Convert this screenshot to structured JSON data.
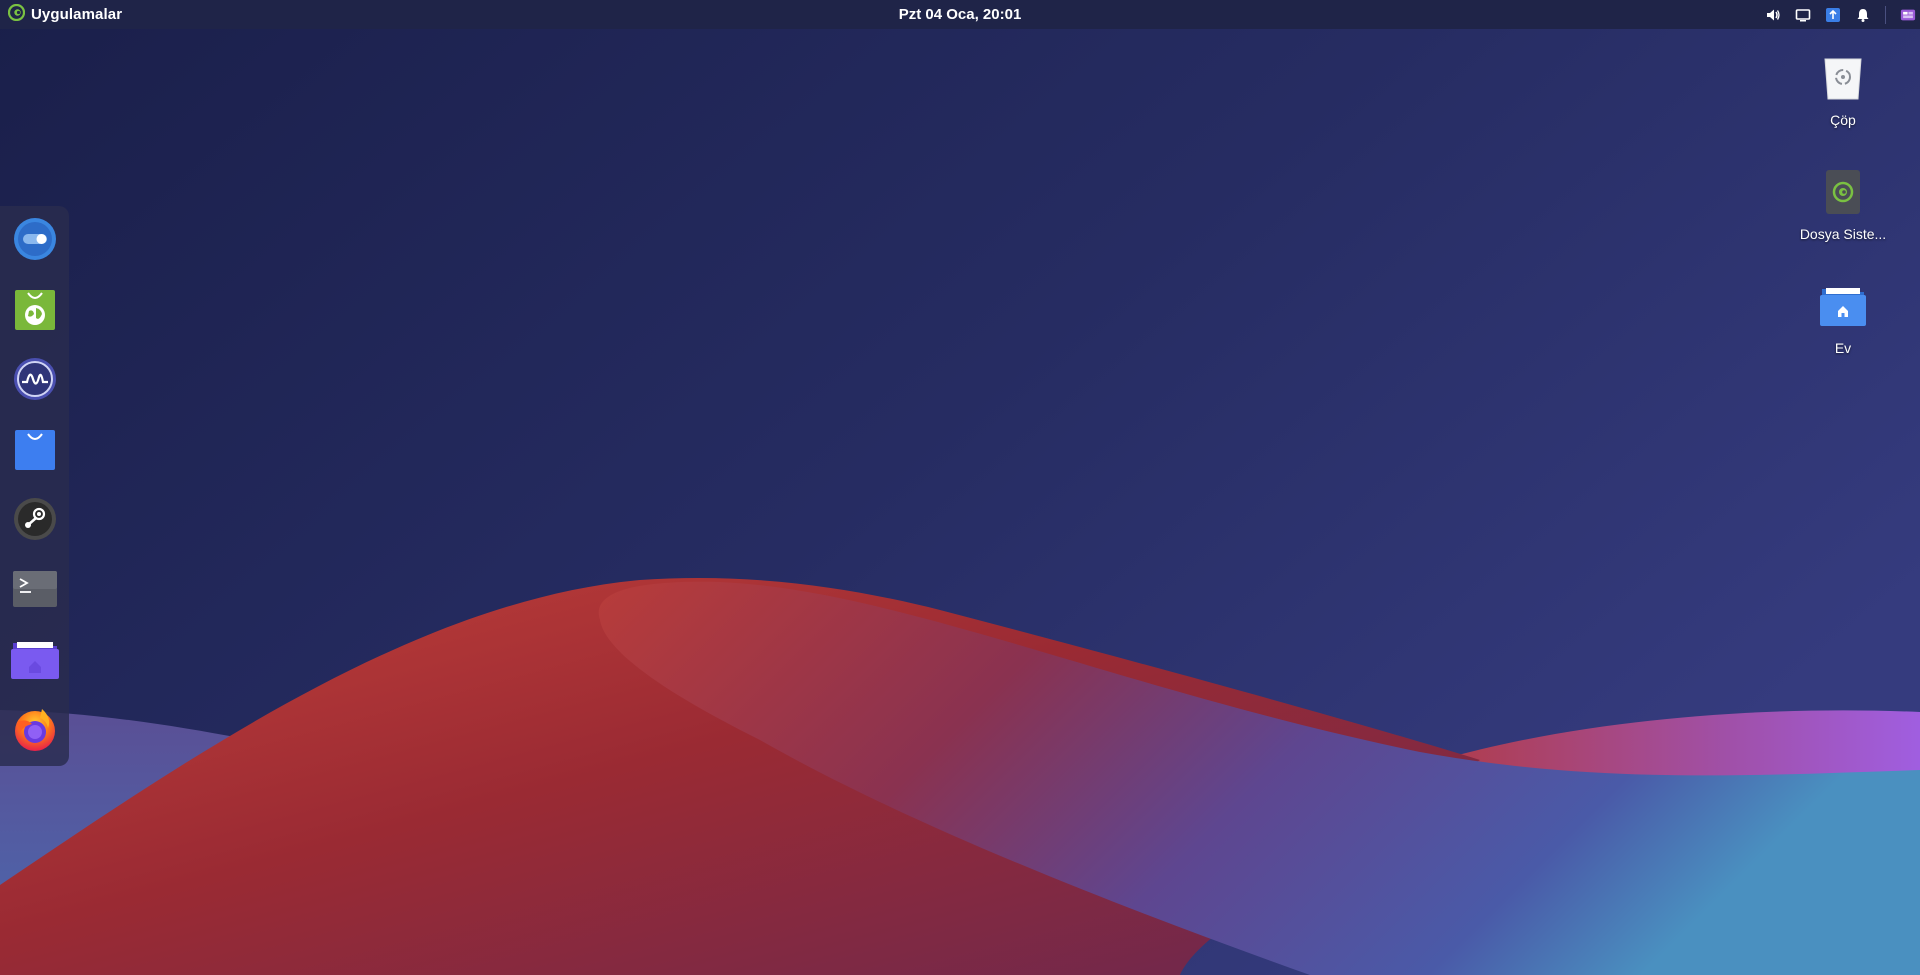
{
  "topbar": {
    "apps_label": "Uygulamalar",
    "clock": "Pzt 04 Oca, 20:01",
    "tray_icons": [
      "volume-icon",
      "screen-icon",
      "network-icon",
      "notification-bell-icon",
      "workspace-switcher-icon"
    ]
  },
  "dock": {
    "items": [
      {
        "name": "settings-toggle-app",
        "icon": "toggle-icon"
      },
      {
        "name": "web-browser-bag-app",
        "icon": "globe-bag-icon"
      },
      {
        "name": "system-monitor-app",
        "icon": "pulse-wave-icon"
      },
      {
        "name": "software-store-app",
        "icon": "shopping-bag-icon"
      },
      {
        "name": "steam-app",
        "icon": "steam-icon"
      },
      {
        "name": "terminal-app",
        "icon": "terminal-icon"
      },
      {
        "name": "file-manager-app",
        "icon": "home-folder-icon"
      },
      {
        "name": "firefox-app",
        "icon": "firefox-icon"
      }
    ]
  },
  "desktop": {
    "icons": [
      {
        "label": "Çöp",
        "icon": "trash-icon"
      },
      {
        "label": "Dosya Siste...",
        "icon": "drive-icon"
      },
      {
        "label": "Ev",
        "icon": "home-folder-icon"
      }
    ]
  },
  "colors": {
    "topbar_bg": "#1f2448",
    "sky_top": "#1d2350",
    "sky_right": "#33397a",
    "dune_red": "#b23a35",
    "dune_purple": "#6a4a9a",
    "dune_teal": "#4a88b8",
    "accent_green": "#7ac142"
  }
}
